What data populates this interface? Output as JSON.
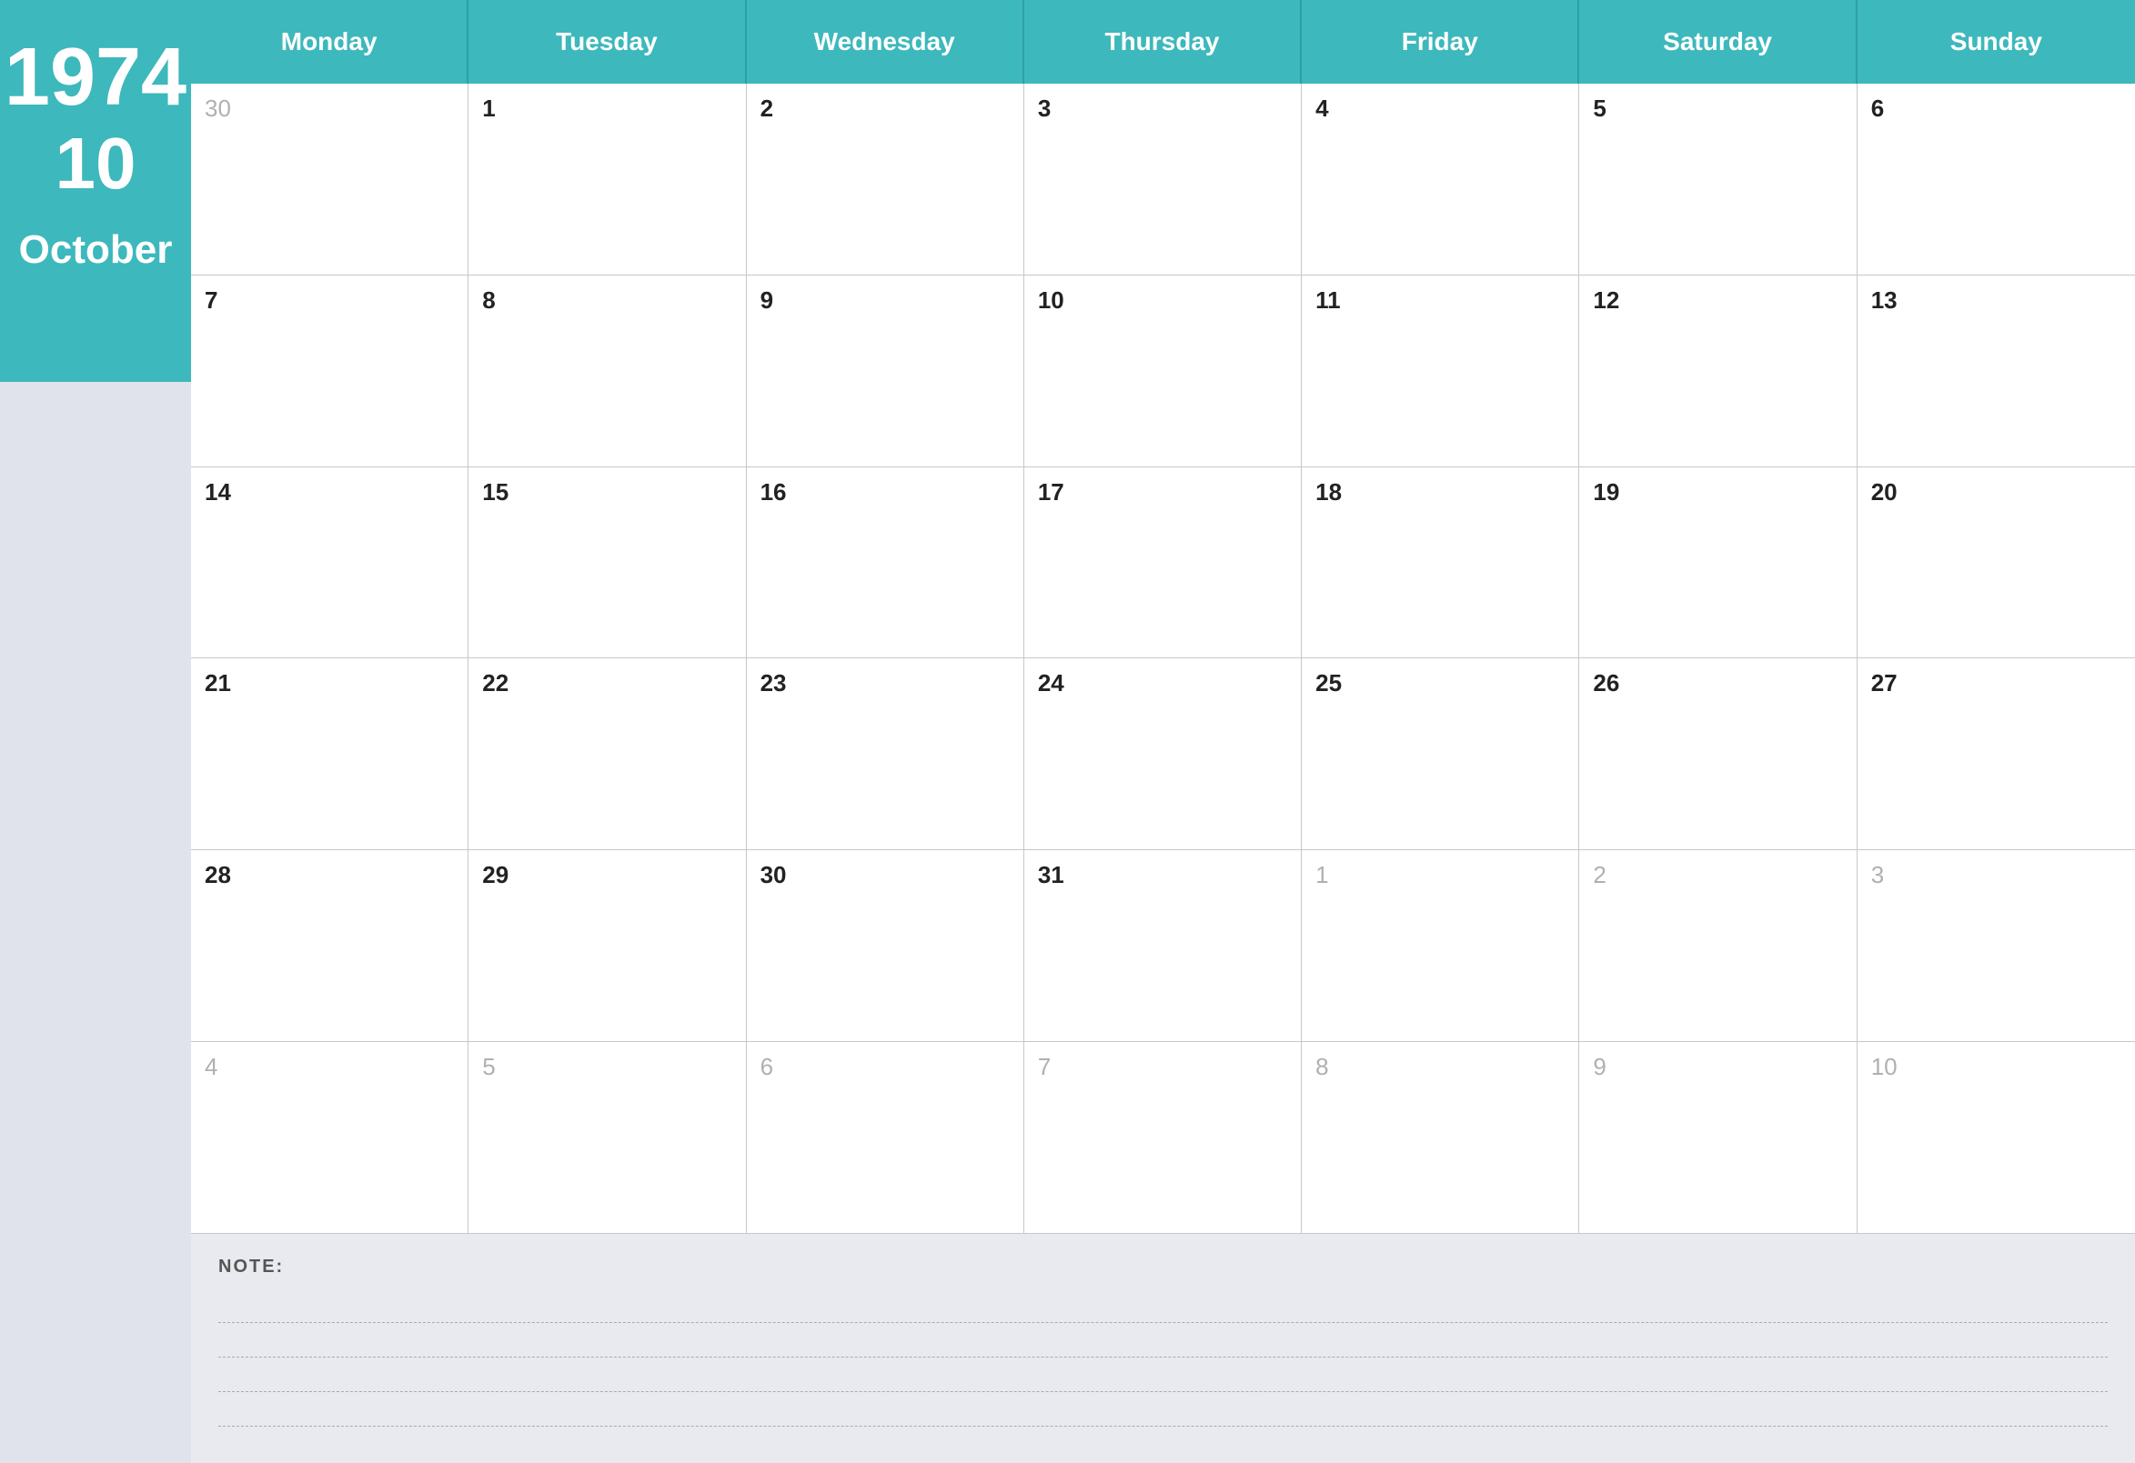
{
  "sidebar": {
    "year": "1974",
    "month_num": "10",
    "month_name": "October"
  },
  "header": {
    "days": [
      "Monday",
      "Tuesday",
      "Wednesday",
      "Thursday",
      "Friday",
      "Saturday",
      "Sunday"
    ]
  },
  "weeks": [
    [
      {
        "day": "30",
        "other": true
      },
      {
        "day": "1",
        "other": false
      },
      {
        "day": "2",
        "other": false
      },
      {
        "day": "3",
        "other": false
      },
      {
        "day": "4",
        "other": false
      },
      {
        "day": "5",
        "other": false
      },
      {
        "day": "6",
        "other": false
      }
    ],
    [
      {
        "day": "7",
        "other": false
      },
      {
        "day": "8",
        "other": false
      },
      {
        "day": "9",
        "other": false
      },
      {
        "day": "10",
        "other": false
      },
      {
        "day": "11",
        "other": false
      },
      {
        "day": "12",
        "other": false
      },
      {
        "day": "13",
        "other": false
      }
    ],
    [
      {
        "day": "14",
        "other": false
      },
      {
        "day": "15",
        "other": false
      },
      {
        "day": "16",
        "other": false
      },
      {
        "day": "17",
        "other": false
      },
      {
        "day": "18",
        "other": false
      },
      {
        "day": "19",
        "other": false
      },
      {
        "day": "20",
        "other": false
      }
    ],
    [
      {
        "day": "21",
        "other": false
      },
      {
        "day": "22",
        "other": false
      },
      {
        "day": "23",
        "other": false
      },
      {
        "day": "24",
        "other": false
      },
      {
        "day": "25",
        "other": false
      },
      {
        "day": "26",
        "other": false
      },
      {
        "day": "27",
        "other": false
      }
    ],
    [
      {
        "day": "28",
        "other": false
      },
      {
        "day": "29",
        "other": false
      },
      {
        "day": "30",
        "other": false
      },
      {
        "day": "31",
        "other": false
      },
      {
        "day": "1",
        "other": true
      },
      {
        "day": "2",
        "other": true
      },
      {
        "day": "3",
        "other": true
      }
    ],
    [
      {
        "day": "4",
        "other": true
      },
      {
        "day": "5",
        "other": true
      },
      {
        "day": "6",
        "other": true
      },
      {
        "day": "7",
        "other": true
      },
      {
        "day": "8",
        "other": true
      },
      {
        "day": "9",
        "other": true
      },
      {
        "day": "10",
        "other": true
      }
    ]
  ],
  "notes": {
    "label": "NOTE:",
    "lines": 4
  }
}
